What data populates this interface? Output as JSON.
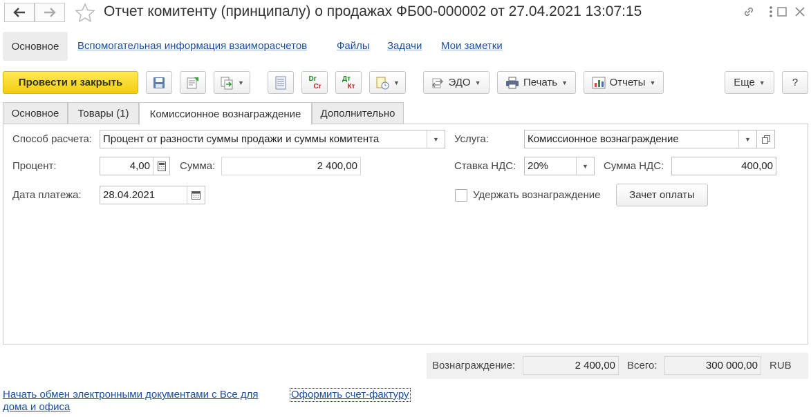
{
  "window": {
    "title": "Отчет комитенту (принципалу) о продажах ФБ00-000002 от 27.04.2021 13:07:15"
  },
  "sections": {
    "active": "Основное",
    "links": [
      "Вспомогательная информация взаиморасчетов",
      "Файлы",
      "Задачи",
      "Мои заметки"
    ]
  },
  "toolbar": {
    "post_close": "Провести и закрыть",
    "edo": "ЭДО",
    "print": "Печать",
    "reports": "Отчеты",
    "more": "Еще",
    "help": "?",
    "dt_top": "Dr",
    "dt_bot": "Cr",
    "kt_top": "Дт",
    "kt_bot": "Кт"
  },
  "tabs": [
    "Основное",
    "Товары (1)",
    "Комиссионное вознаграждение",
    "Дополнительно"
  ],
  "active_tab": 2,
  "form": {
    "method_label": "Способ расчета:",
    "method_value": "Процент от разности суммы продажи и суммы комитента",
    "percent_label": "Процент:",
    "percent_value": "4,00",
    "sum_label": "Сумма:",
    "sum_value": "2 400,00",
    "date_label": "Дата платежа:",
    "date_value": "28.04.2021",
    "service_label": "Услуга:",
    "service_value": "Комиссионное вознаграждение",
    "vat_rate_label": "Ставка НДС:",
    "vat_rate_value": "20%",
    "vat_sum_label": "Сумма НДС:",
    "vat_sum_value": "400,00",
    "withhold_label": "Удержать вознаграждение",
    "withhold_checked": false,
    "offset_button": "Зачет оплаты"
  },
  "totals": {
    "reward_label": "Вознаграждение:",
    "reward_value": "2 400,00",
    "total_label": "Всего:",
    "total_value": "300 000,00",
    "currency": "RUB"
  },
  "footer": {
    "edo_link": "Начать обмен электронными документами с Все для дома и офиса",
    "invoice_link": "Оформить счет-фактуру"
  },
  "colors": {
    "primary_button": "#f5d31d",
    "link": "#1b4fa0"
  }
}
